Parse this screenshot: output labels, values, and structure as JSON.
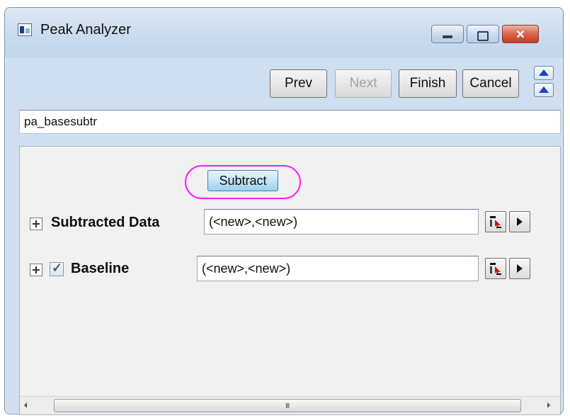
{
  "window": {
    "title": "Peak Analyzer",
    "icon": "app-window-icon",
    "controls": {
      "minimize": "minimize-icon",
      "maximize": "maximize-icon",
      "close": "close-icon",
      "close_glyph": "✕"
    }
  },
  "toolbar": {
    "prev_label": "Prev",
    "next_label": "Next",
    "finish_label": "Finish",
    "cancel_label": "Cancel"
  },
  "name_field": {
    "value": "pa_basesubtr"
  },
  "panel": {
    "subtract_label": "Subtract",
    "highlight_color": "#ff1bff",
    "rows": [
      {
        "label": "Subtracted Data",
        "value": "(<new>,<new>)",
        "checked": null
      },
      {
        "label": "Baseline",
        "value": "(<new>,<new>)",
        "checked": true
      }
    ],
    "scrollbar": {
      "grip": "III"
    }
  },
  "colors": {
    "accent": "#1244b8",
    "subtract_button": "#98d1ef"
  }
}
